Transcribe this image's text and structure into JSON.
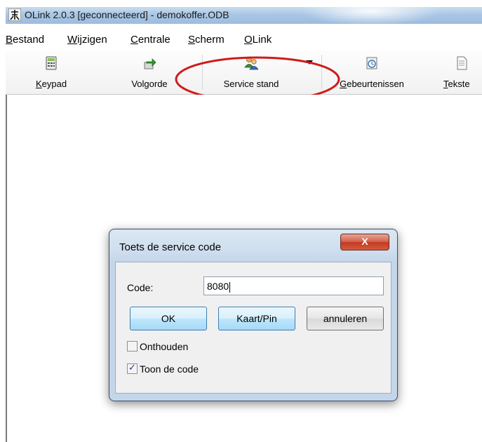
{
  "window": {
    "title": "OLink 2.0.3 [geconnecteerd] - demokoffer.ODB"
  },
  "menu": {
    "items": [
      {
        "pre": "",
        "ul": "B",
        "post": "estand"
      },
      {
        "pre": "",
        "ul": "W",
        "post": "ijzigen"
      },
      {
        "pre": "",
        "ul": "C",
        "post": "entrale"
      },
      {
        "pre": "",
        "ul": "S",
        "post": "cherm"
      },
      {
        "pre": "",
        "ul": "O",
        "post": "Link"
      }
    ]
  },
  "toolbar": {
    "keypad": {
      "ul": "K",
      "rest": "eypad",
      "icon": "keypad-icon"
    },
    "volgorde": {
      "label": "Volgorde",
      "icon": "sequence-arrow-icon"
    },
    "service_stand": {
      "label": "Service stand",
      "icon": "service-people-icon"
    },
    "gebeurtenissen": {
      "ul": "G",
      "rest": "ebeurtenissen",
      "icon": "events-clock-icon"
    },
    "teksten": {
      "ul": "T",
      "rest": "ekste",
      "icon": "document-icon"
    }
  },
  "dialog": {
    "title": "Toets de service code",
    "close_label": "X",
    "code_label": "Code:",
    "code_value": "8080",
    "ok_label": "OK",
    "kaart_label": "Kaart/Pin",
    "cancel_label": "annuleren",
    "remember_label": "Onthouden",
    "remember_checked": false,
    "show_code_label": "Toon de code",
    "show_code_checked": true
  },
  "colors": {
    "highlight_ellipse": "#d11a1a",
    "close_button": "#c23a22",
    "titlebar": "#a9c6e4"
  }
}
